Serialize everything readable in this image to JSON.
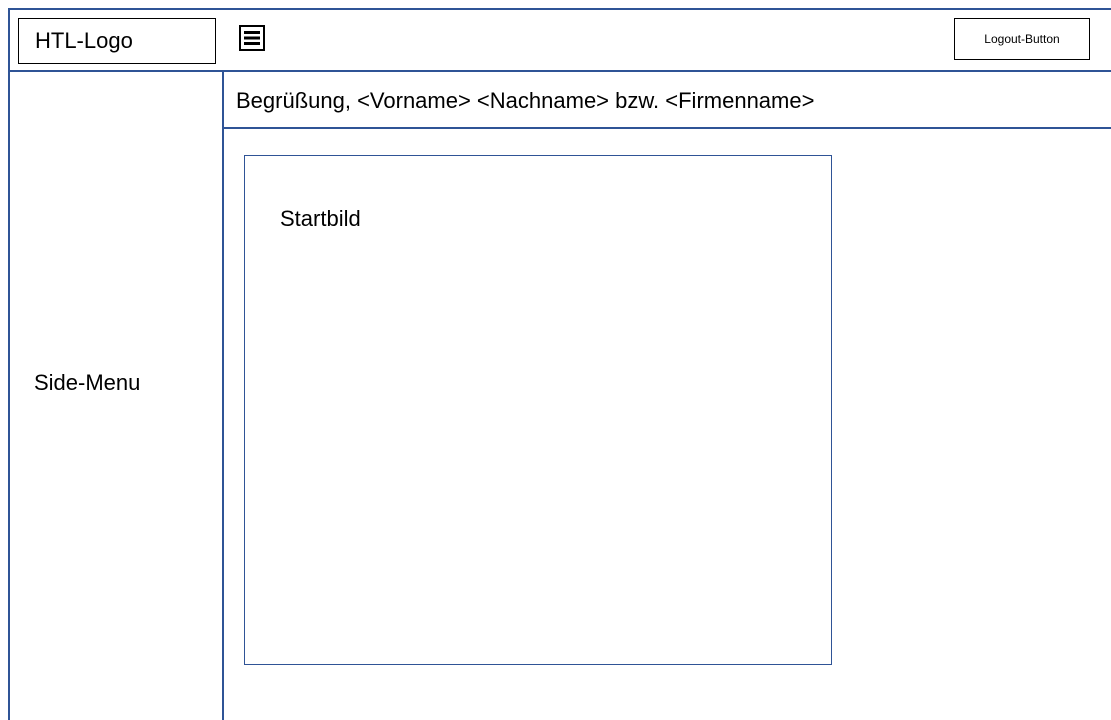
{
  "header": {
    "logo_label": "HTL-Logo",
    "menu_icon": "hamburger-menu-icon",
    "logout_label": "Logout-Button"
  },
  "sidebar": {
    "label": "Side-Menu"
  },
  "main": {
    "greeting": "Begrüßung, <Vorname> <Nachname> bzw. <Firmenname>",
    "start_image_label": "Startbild"
  },
  "colors": {
    "border": "#2f5496",
    "text": "#000000",
    "background": "#ffffff"
  }
}
